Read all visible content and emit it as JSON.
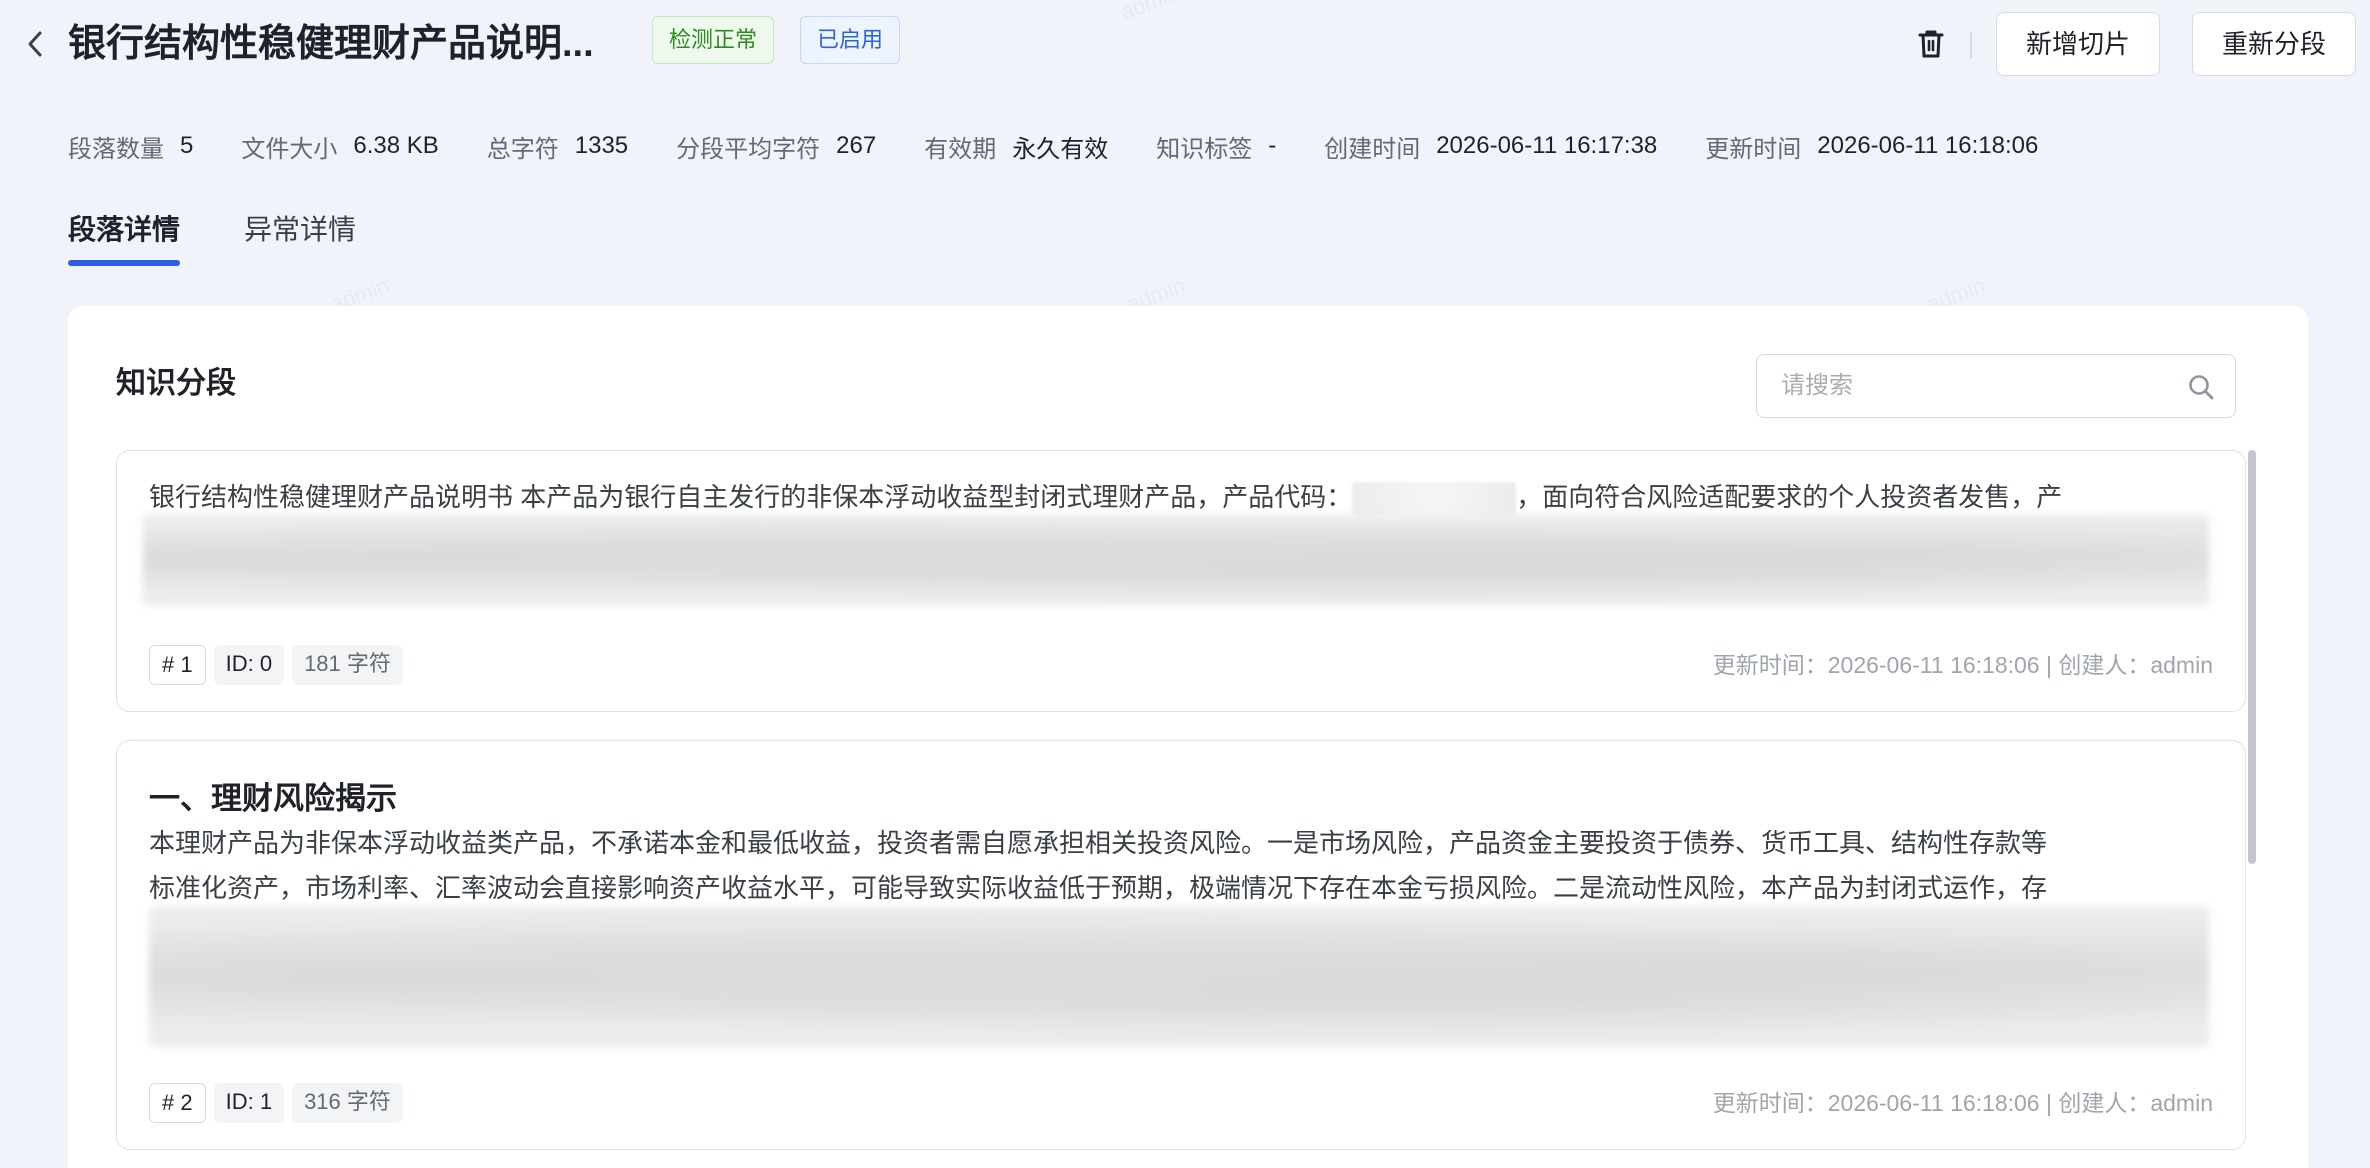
{
  "header": {
    "title": "银行结构性稳健理财产品说明...",
    "badges": [
      {
        "label": "检测正常",
        "color": "#2d8a22"
      },
      {
        "label": "已启用",
        "color": "#2b65d9"
      }
    ],
    "add_slice_label": "新增切片",
    "resplit_label": "重新分段"
  },
  "meta": [
    {
      "label": "段落数量",
      "value": "5"
    },
    {
      "label": "文件大小",
      "value": "6.38 KB"
    },
    {
      "label": "总字符",
      "value": "1335"
    },
    {
      "label": "分段平均字符",
      "value": "267"
    },
    {
      "label": "有效期",
      "value": "永久有效"
    },
    {
      "label": "知识标签",
      "value": "-"
    },
    {
      "label": "创建时间",
      "value": "2026-06-11 16:17:38"
    },
    {
      "label": "更新时间",
      "value": "2026-06-11 16:18:06"
    }
  ],
  "tabs": [
    {
      "label": "段落详情",
      "active": true
    },
    {
      "label": "异常详情",
      "active": false
    }
  ],
  "watermark": "admin",
  "card": {
    "title": "知识分段",
    "search_placeholder": "请搜索"
  },
  "segments": [
    {
      "heading": "",
      "lines": [
        {
          "before": "银行结构性稳健理财产品说明书 本产品为银行自主发行的非保本浮动收益型封闭式理财产品，产品代码：",
          "after": "，面向符合风险适配要求的个人投资者发售，产"
        }
      ],
      "num": "# 1",
      "id": "ID: 0",
      "chars": "181 字符",
      "footer": "更新时间：2026-06-11 16:18:06 | 创建人：admin"
    },
    {
      "heading": "一、理财风险揭示",
      "lines": [
        {
          "text": "本理财产品为非保本浮动收益类产品，不承诺本金和最低收益，投资者需自愿承担相关投资风险。一是市场风险，产品资金主要投资于债券、货币工具、结构性存款等"
        },
        {
          "text": "标准化资产，市场利率、汇率波动会直接影响资产收益水平，可能导致实际收益低于预期，极端情况下存在本金亏损风险。二是流动性风险，本产品为封闭式运作，存"
        }
      ],
      "num": "# 2",
      "id": "ID: 1",
      "chars": "316 字符",
      "footer": "更新时间：2026-06-11 16:18:06 | 创建人：admin"
    }
  ],
  "colors": {
    "accent": "#2b5fe0",
    "background": "#f0f3fa",
    "status_ok": "#2d8a22",
    "status_enabled": "#2b65d9"
  }
}
